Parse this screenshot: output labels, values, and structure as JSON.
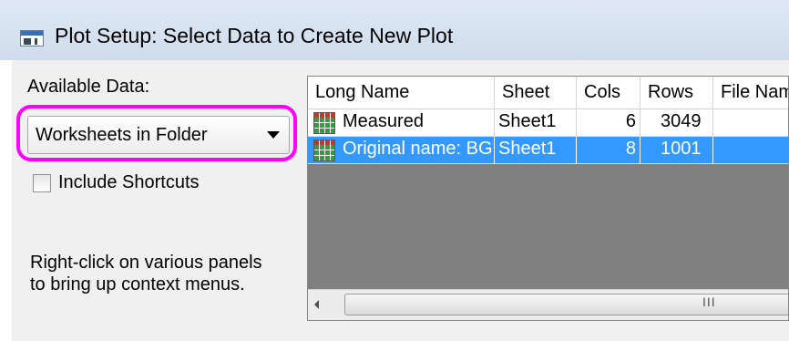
{
  "window": {
    "title": "Plot Setup: Select Data to Create New Plot"
  },
  "left_panel": {
    "available_data_label": "Available Data:",
    "data_source_select": {
      "selected": "Worksheets in Folder"
    },
    "include_shortcuts": {
      "label": "Include Shortcuts",
      "checked": false
    },
    "hint_line1": "Right-click on various panels",
    "hint_line2": "to bring up context menus.",
    "highlight_color": "#ff00ff"
  },
  "table": {
    "columns": [
      "Long Name",
      "Sheet",
      "Cols",
      "Rows",
      "File Nam"
    ],
    "rows": [
      {
        "long_name": "Measured",
        "sheet": "Sheet1",
        "cols": "6",
        "rows": "3049",
        "file_name": "",
        "icon": "worksheet-icon",
        "selected": false
      },
      {
        "long_name": "Original name: BG",
        "sheet": "Sheet1",
        "cols": "8",
        "rows": "1001",
        "file_name": "",
        "icon": "worksheet-icon",
        "selected": true
      }
    ],
    "scroll_grip": "III",
    "selection_color": "#3399ff"
  }
}
